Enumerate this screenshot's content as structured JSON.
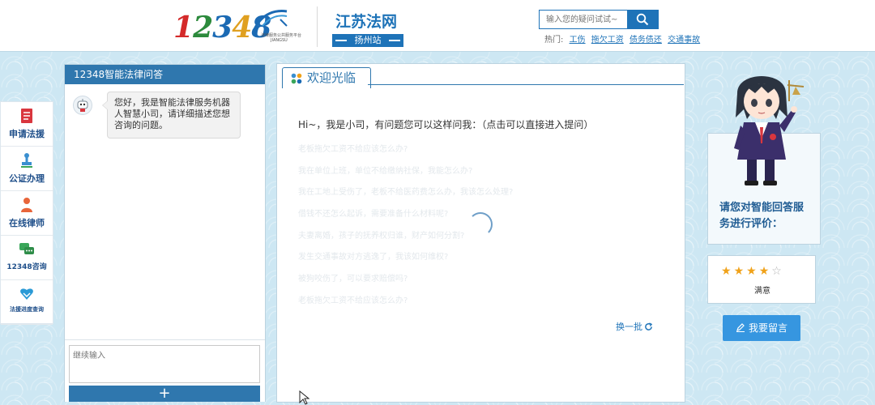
{
  "header": {
    "logo": {
      "number": "12348",
      "subtitle": "法律服务公共服务平台",
      "region": "JIANGSU"
    },
    "site_title": "江苏法网",
    "site_sub": "扬州站",
    "search": {
      "placeholder": "输入您的疑问试试~"
    },
    "hot": {
      "label": "热门:",
      "links": [
        "工伤",
        "拖欠工资",
        "债务债还",
        "交通事故"
      ]
    }
  },
  "sidenav": {
    "items": [
      {
        "label": "申请法援",
        "icon": "book-icon"
      },
      {
        "label": "公证办理",
        "icon": "stamp-icon"
      },
      {
        "label": "在线律师",
        "icon": "lawyer-icon"
      },
      {
        "label": "12348咨询",
        "icon": "chat-bubbles-icon"
      },
      {
        "label": "法援进度查询",
        "icon": "heart-hands-icon"
      }
    ]
  },
  "chat": {
    "title": "12348智能法律问答",
    "greeting": "您好，我是智能法律服务机器人智慧小司，请详细描述您想咨询的问题。",
    "input_placeholder": "继续输入",
    "send_label": "+"
  },
  "welcome": {
    "tab_label": "欢迎光临",
    "intro": "Hi~，我是小司，有问题您可以这样问我：（点击可以直接进入提问）",
    "refresh_label": "换一批",
    "questions": [
      "老板拖欠工资不给应该怎么办?",
      "我在单位上班，单位不给缴纳社保，我能怎么办?",
      "我在工地上受伤了，老板不给医药费怎么办，我该怎么处理?",
      "借钱不还怎么起诉，需要准备什么材料呢?",
      "夫妻离婚，孩子的抚养权归谁，财产如何分割?",
      "发生交通事故对方逃逸了，我该如何维权?",
      "被狗咬伤了，可以要求赔偿吗?",
      "老板拖欠工资不给应该怎么办?"
    ]
  },
  "rating": {
    "prompt": "请您对智能回答服务进行评价：",
    "stars_total": 5,
    "stars_on": 4,
    "stars_label": "满意",
    "star_color": "#f0a21a"
  },
  "leave_message": {
    "label": "我要留言"
  },
  "colors": {
    "primary": "#2f77ae",
    "link": "#1e73b8",
    "button": "#3696e0"
  }
}
